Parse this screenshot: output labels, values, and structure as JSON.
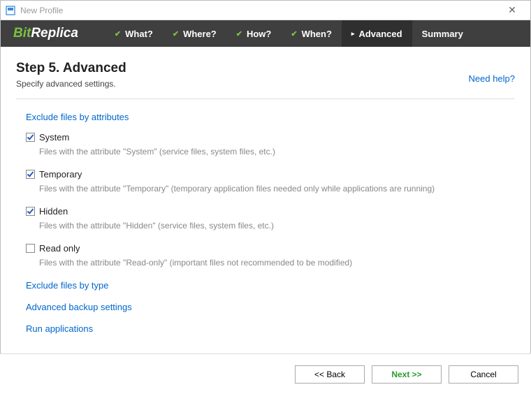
{
  "window": {
    "title": "New Profile"
  },
  "logo": {
    "bit": "Bit",
    "replica": "Replica"
  },
  "nav": {
    "items": [
      {
        "label": "What?",
        "state": "done"
      },
      {
        "label": "Where?",
        "state": "done"
      },
      {
        "label": "How?",
        "state": "done"
      },
      {
        "label": "When?",
        "state": "done"
      },
      {
        "label": "Advanced",
        "state": "current"
      },
      {
        "label": "Summary",
        "state": "future"
      }
    ]
  },
  "header": {
    "title": "Step 5. Advanced",
    "subtitle": "Specify advanced settings.",
    "help": "Need help?"
  },
  "sections": {
    "exclude_attrs_title": "Exclude files by attributes",
    "options": [
      {
        "label": "System",
        "checked": true,
        "desc": "Files with the attribute \"System\" (service files, system files, etc.)"
      },
      {
        "label": "Temporary",
        "checked": true,
        "desc": "Files with the attribute \"Temporary\" (temporary application files needed only while applications are running)"
      },
      {
        "label": "Hidden",
        "checked": true,
        "desc": "Files with the attribute \"Hidden\" (service files, system files, etc.)"
      },
      {
        "label": "Read only",
        "checked": false,
        "desc": "Files with the attribute \"Read-only\" (important files not recommended to be modified)"
      }
    ],
    "exclude_type_title": "Exclude files by type",
    "advanced_backup_title": "Advanced backup settings",
    "run_apps_title": "Run applications"
  },
  "footer": {
    "back": "<< Back",
    "next": "Next >>",
    "cancel": "Cancel"
  }
}
